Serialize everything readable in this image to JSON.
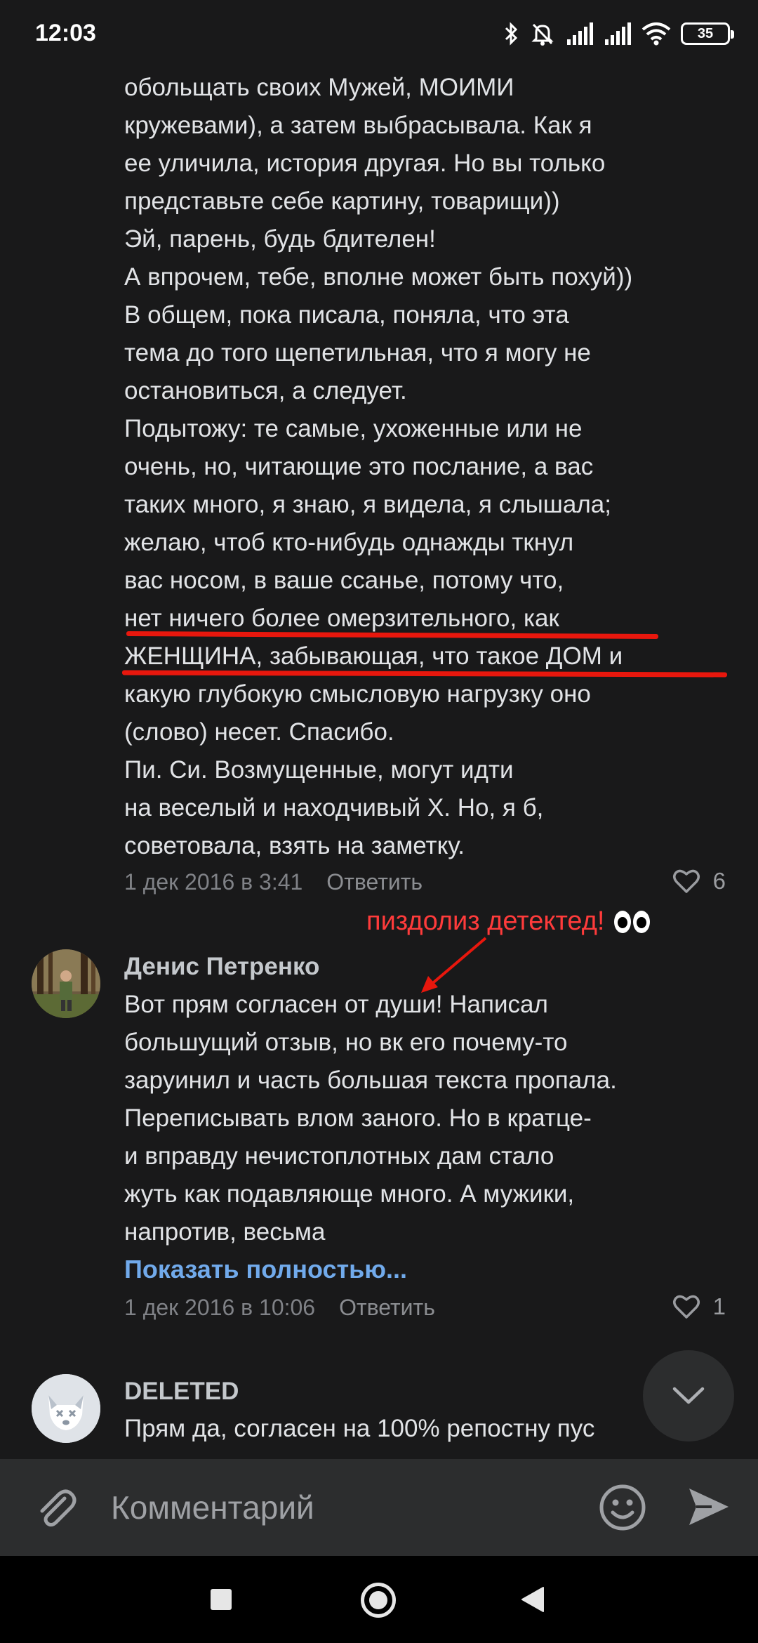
{
  "status_bar": {
    "time": "12:03",
    "battery": "35",
    "icons": [
      "bluetooth-icon",
      "mute-icon",
      "signal-icon",
      "signal-icon",
      "wifi-icon",
      "battery-icon"
    ]
  },
  "comments": [
    {
      "text_lines": [
        "обольщать своих Мужей, МОИМИ",
        "кружевами), а затем выбрасывала. Как я",
        "ее уличила, история другая. Но вы только",
        "представьте себе картину, товарищи))",
        "Эй, парень, будь бдителен!",
        "А впрочем, тебе, вполне может быть похуй))",
        "В общем, пока писала, поняла, что эта",
        "тема до того щепетильная, что я могу не",
        "остановиться, а следует.",
        "Подытожу: те самые, ухоженные или не",
        "очень, но, читающие это послание, а вас",
        "таких много, я знаю, я видела, я слышала;",
        "желаю, чтоб кто-нибудь однажды ткнул",
        "вас носом, в ваше ссанье, потому что,",
        "нет ничего более омерзительного, как",
        "ЖЕНЩИНА, забывающая, что такое ДОМ и",
        "какую глубокую смысловую нагрузку оно",
        "(слово) несет. Спасибо.",
        "Пи. Си. Возмущенные, могут идти",
        "на веселый и находчивый Х. Но, я б,",
        "советовала, взять на заметку."
      ],
      "date": "1 дек 2016 в 3:41",
      "reply_label": "Ответить",
      "likes": "6"
    },
    {
      "author": "Денис Петренко",
      "text_lines": [
        "Вот прям согласен от души! Написал",
        "большущий отзыв, но вк его почему-то",
        "заруинил и часть большая текста пропала.",
        "Переписывать влом заного. Но в кратце-",
        "и вправду нечистоплотных дам стало",
        "жуть как подавляюще много. А мужики,",
        "напротив, весьма"
      ],
      "show_more": "Показать полностью...",
      "date": "1 дек 2016 в 10:06",
      "reply_label": "Ответить",
      "likes": "1"
    },
    {
      "author": "DELETED",
      "text_lines": [
        "Прям да, согласен на 100% репостну пус"
      ]
    }
  ],
  "annotation": {
    "text": "пиздолиз детектед!",
    "color": "#ff3b3b"
  },
  "input": {
    "placeholder": "Комментарий"
  },
  "colors": {
    "background": "#19191a",
    "text": "#e1e3e6",
    "link": "#71aaeb",
    "meta": "#808287",
    "underline": "#e8170d"
  }
}
